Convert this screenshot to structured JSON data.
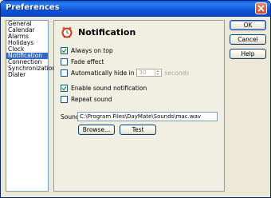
{
  "window": {
    "title": "Preferences"
  },
  "sidebar": {
    "items": [
      {
        "label": "General",
        "selected": false
      },
      {
        "label": "Calendar",
        "selected": false
      },
      {
        "label": "Alarms",
        "selected": false
      },
      {
        "label": "Holidays",
        "selected": false
      },
      {
        "label": "Clock",
        "selected": false
      },
      {
        "label": "Notification",
        "selected": true
      },
      {
        "label": "Connection",
        "selected": false
      },
      {
        "label": "Synchronization",
        "selected": false
      },
      {
        "label": "Dialer",
        "selected": false
      }
    ]
  },
  "panel": {
    "title": "Notification",
    "icon": "alarm-clock-icon",
    "options": {
      "always_on_top": {
        "label": "Always on top",
        "checked": true
      },
      "fade_effect": {
        "label": "Fade effect",
        "checked": false
      },
      "auto_hide": {
        "label": "Automatically hide in",
        "checked": false,
        "value": "30",
        "unit": "seconds"
      },
      "enable_sound": {
        "label": "Enable sound notification",
        "checked": true
      },
      "repeat_sound": {
        "label": "Repeat sound",
        "checked": false
      }
    },
    "sound": {
      "label": "Sound",
      "path": "C:\\Program Files\\DayMate\\Sounds\\mac.wav",
      "browse_label": "Browse...",
      "test_label": "Test"
    }
  },
  "buttons": {
    "ok": "OK",
    "cancel": "Cancel",
    "help": "Help"
  },
  "colors": {
    "titlebar": "#0a5ee6",
    "selection": "#316ac5",
    "dialog_bg": "#ece9d8"
  }
}
